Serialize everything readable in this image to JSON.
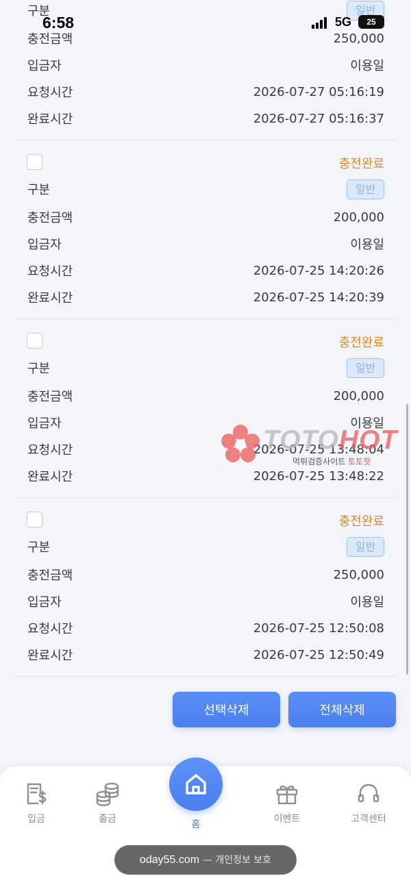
{
  "status_bar": {
    "time": "6:58",
    "network": "5G",
    "battery": "25"
  },
  "labels": {
    "category": "구분",
    "amount": "충전금액",
    "depositor": "입금자",
    "request_time": "요청시간",
    "complete_time": "완료시간"
  },
  "records": [
    {
      "status": "",
      "category_badge": "일반",
      "amount": "250,000",
      "depositor": "이용일",
      "request_time": "2026-07-27 05:16:19",
      "complete_time": "2026-07-27 05:16:37"
    },
    {
      "status": "충전완료",
      "category_badge": "일반",
      "amount": "200,000",
      "depositor": "이용일",
      "request_time": "2026-07-25 14:20:26",
      "complete_time": "2026-07-25 14:20:39"
    },
    {
      "status": "충전완료",
      "category_badge": "일반",
      "amount": "200,000",
      "depositor": "이용일",
      "request_time": "2026-07-25 13:48:04",
      "complete_time": "2026-07-25 13:48:22"
    },
    {
      "status": "충전완료",
      "category_badge": "일반",
      "amount": "250,000",
      "depositor": "이용일",
      "request_time": "2026-07-25 12:50:08",
      "complete_time": "2026-07-25 12:50:49"
    }
  ],
  "actions": {
    "delete_selected": "선택삭제",
    "delete_all": "전체삭제"
  },
  "watermark": {
    "brand_a": "TOTO",
    "brand_b": "HOT",
    "sub_a": "먹튀검증사이트",
    "sub_b": "토토핫"
  },
  "tabbar": {
    "deposit": "입금",
    "withdraw": "출금",
    "home": "홈",
    "event": "이벤트",
    "support": "고객센터"
  },
  "browser": {
    "domain": "oday55.com",
    "privacy": "— 개인정보 보호"
  },
  "colors": {
    "accent": "#4a7ff0",
    "status_complete": "#e8871e",
    "badge_bg": "#dbe9fb"
  }
}
